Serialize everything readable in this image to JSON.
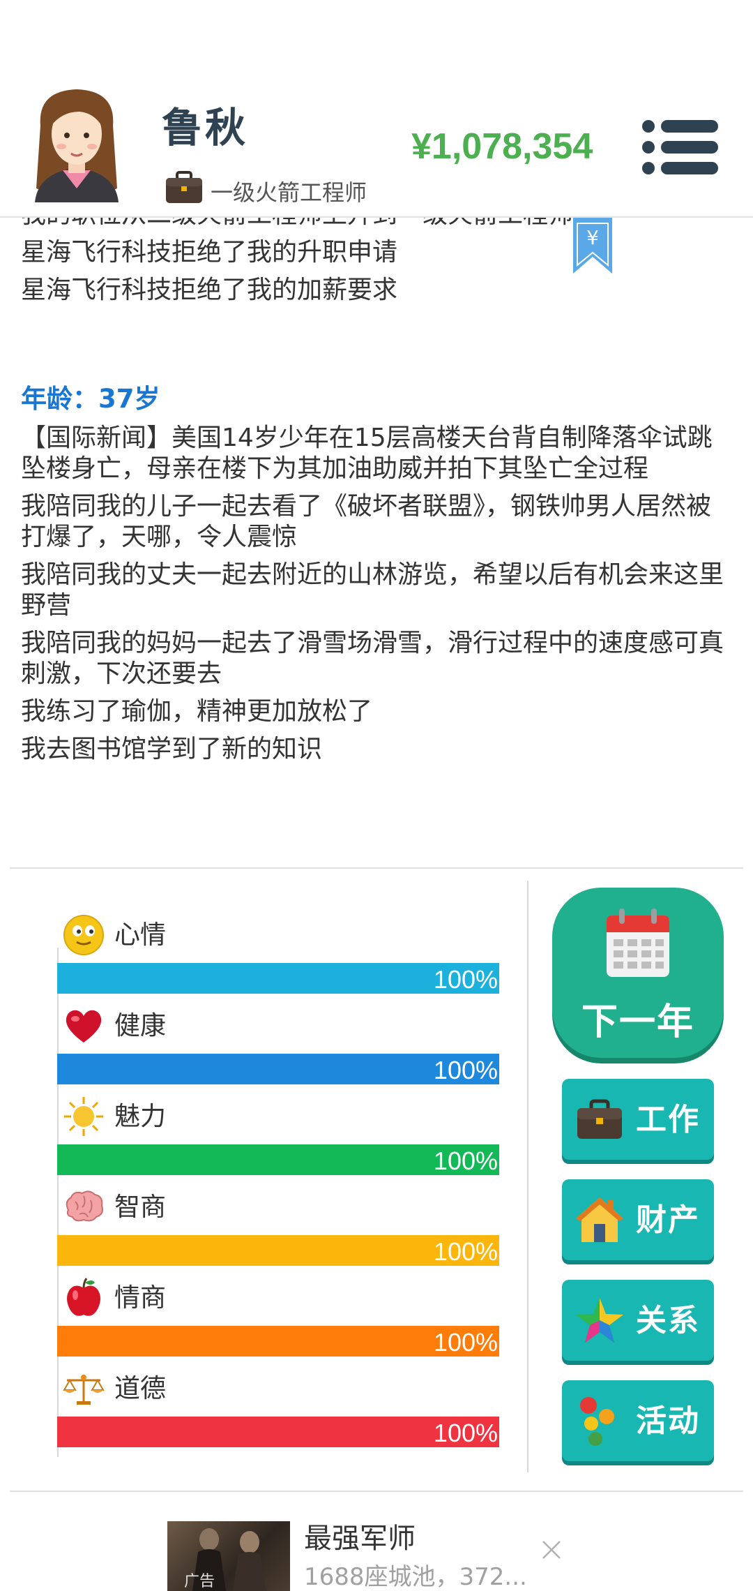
{
  "header": {
    "name": "鲁秋",
    "job_title": "一级火箭工程师",
    "money": "¥1,078,354",
    "bookmark_symbol": "¥"
  },
  "log": {
    "lines_before": [
      "我的职位从二级火箭工程师上升到一级火箭工程师",
      "星海飞行科技拒绝了我的升职申请",
      "星海飞行科技拒绝了我的加薪要求"
    ],
    "age_label": "年龄：37岁",
    "lines_after": [
      "【国际新闻】美国14岁少年在15层高楼天台背自制降落伞试跳坠楼身亡，母亲在楼下为其加油助威并拍下其坠亡全过程",
      "我陪同我的儿子一起去看了《破坏者联盟》，钢铁帅男人居然被打爆了，天哪，令人震惊",
      "我陪同我的丈夫一起去附近的山林游览，希望以后有机会来这里野营",
      "我陪同我的妈妈一起去了滑雪场滑雪，滑行过程中的速度感可真刺激，下次还要去",
      "我练习了瑜伽，精神更加放松了",
      "我去图书馆学到了新的知识"
    ]
  },
  "stats": [
    {
      "label": "心情",
      "value": "100%",
      "fraction": 1.0,
      "color": "#1cb1dc",
      "icon": "smiley-face-icon"
    },
    {
      "label": "健康",
      "value": "100%",
      "fraction": 1.0,
      "color": "#1e88dc",
      "icon": "heart-icon"
    },
    {
      "label": "魅力",
      "value": "100%",
      "fraction": 1.0,
      "color": "#13b956",
      "icon": "sun-icon"
    },
    {
      "label": "智商",
      "value": "100%",
      "fraction": 1.0,
      "color": "#fcb50a",
      "icon": "brain-icon"
    },
    {
      "label": "情商",
      "value": "100%",
      "fraction": 1.0,
      "color": "#fd7c0a",
      "icon": "apple-icon"
    },
    {
      "label": "道德",
      "value": "100%",
      "fraction": 1.0,
      "color": "#ef3341",
      "icon": "scales-icon"
    }
  ],
  "actions": {
    "next_year": "下一年",
    "work": "工作",
    "property": "财产",
    "relations": "关系",
    "activities": "活动"
  },
  "ad": {
    "title": "最强军师",
    "description": "1688座城池，372...",
    "tag": "广告"
  },
  "colors": {
    "money": "#4caf50",
    "age": "#1976d2",
    "next_year_button": "#21b08e",
    "action_button": "#19b7b2"
  }
}
